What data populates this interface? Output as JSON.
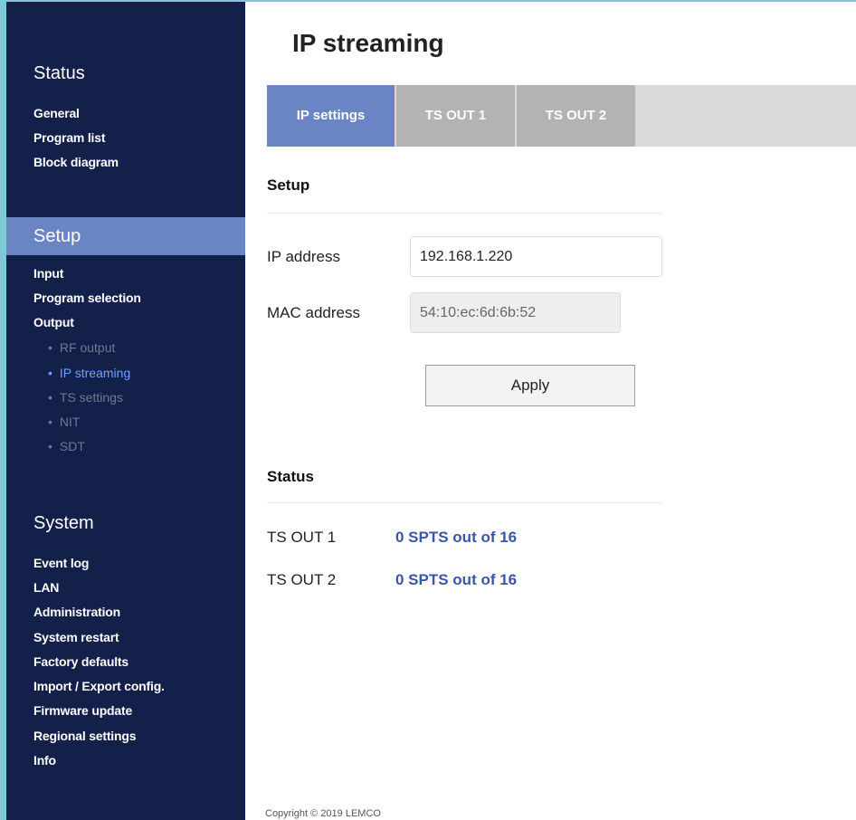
{
  "sidebar": {
    "status_heading": "Status",
    "status_links": [
      "General",
      "Program list",
      "Block diagram"
    ],
    "setup_heading": "Setup",
    "setup_links": [
      "Input",
      "Program selection",
      "Output"
    ],
    "output_sublinks": [
      "RF output",
      "IP streaming",
      "TS settings",
      "NIT",
      "SDT"
    ],
    "active_sublink": "IP streaming",
    "system_heading": "System",
    "system_links": [
      "Event log",
      "LAN",
      "Administration",
      "System restart",
      "Factory defaults",
      "Import / Export config.",
      "Firmware update",
      "Regional settings",
      "Info"
    ]
  },
  "main": {
    "title": "IP streaming",
    "tabs": [
      "IP settings",
      "TS OUT 1",
      "TS OUT 2"
    ],
    "active_tab": "IP settings",
    "setup_title": "Setup",
    "ip_label": "IP address",
    "ip_value": "192.168.1.220",
    "mac_label": "MAC address",
    "mac_value": "54:10:ec:6d:6b:52",
    "apply_label": "Apply",
    "status_title": "Status",
    "status_rows": [
      {
        "label": "TS OUT 1",
        "value": "0 SPTS out of 16"
      },
      {
        "label": "TS OUT 2",
        "value": "0 SPTS out of 16"
      }
    ],
    "copyright": "Copyright © 2019 LEMCO"
  },
  "colors": {
    "sidebar_bg": "#13204a",
    "accent": "#6b85c4",
    "active_link": "#6fa0ff",
    "status_value": "#3a56a6",
    "frame_border": "#7fc8d6"
  }
}
